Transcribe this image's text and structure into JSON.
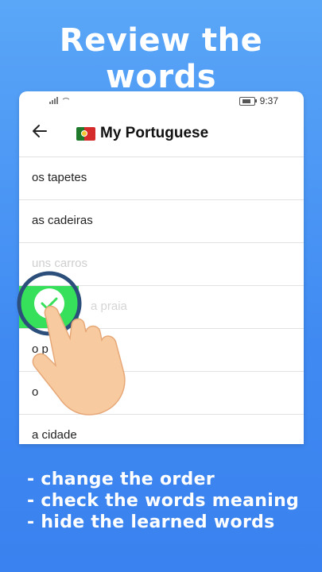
{
  "headline": "Review the words",
  "statusbar": {
    "time": "9:37"
  },
  "appbar": {
    "title": "My Portuguese",
    "flag_icon": "portugal-flag-icon"
  },
  "words": [
    {
      "text": "os tapetes"
    },
    {
      "text": "as cadeiras"
    },
    {
      "text": "uns carros"
    },
    {
      "text": "a praia"
    },
    {
      "text": "o p"
    },
    {
      "text": "o"
    },
    {
      "text": "a cidade"
    }
  ],
  "features": [
    "- change the order",
    "- check the words meaning",
    "- hide the learned words"
  ],
  "colors": {
    "background": "#3f8af2",
    "swipe_green": "#36e05a",
    "hand_skin": "#f7caa0"
  }
}
